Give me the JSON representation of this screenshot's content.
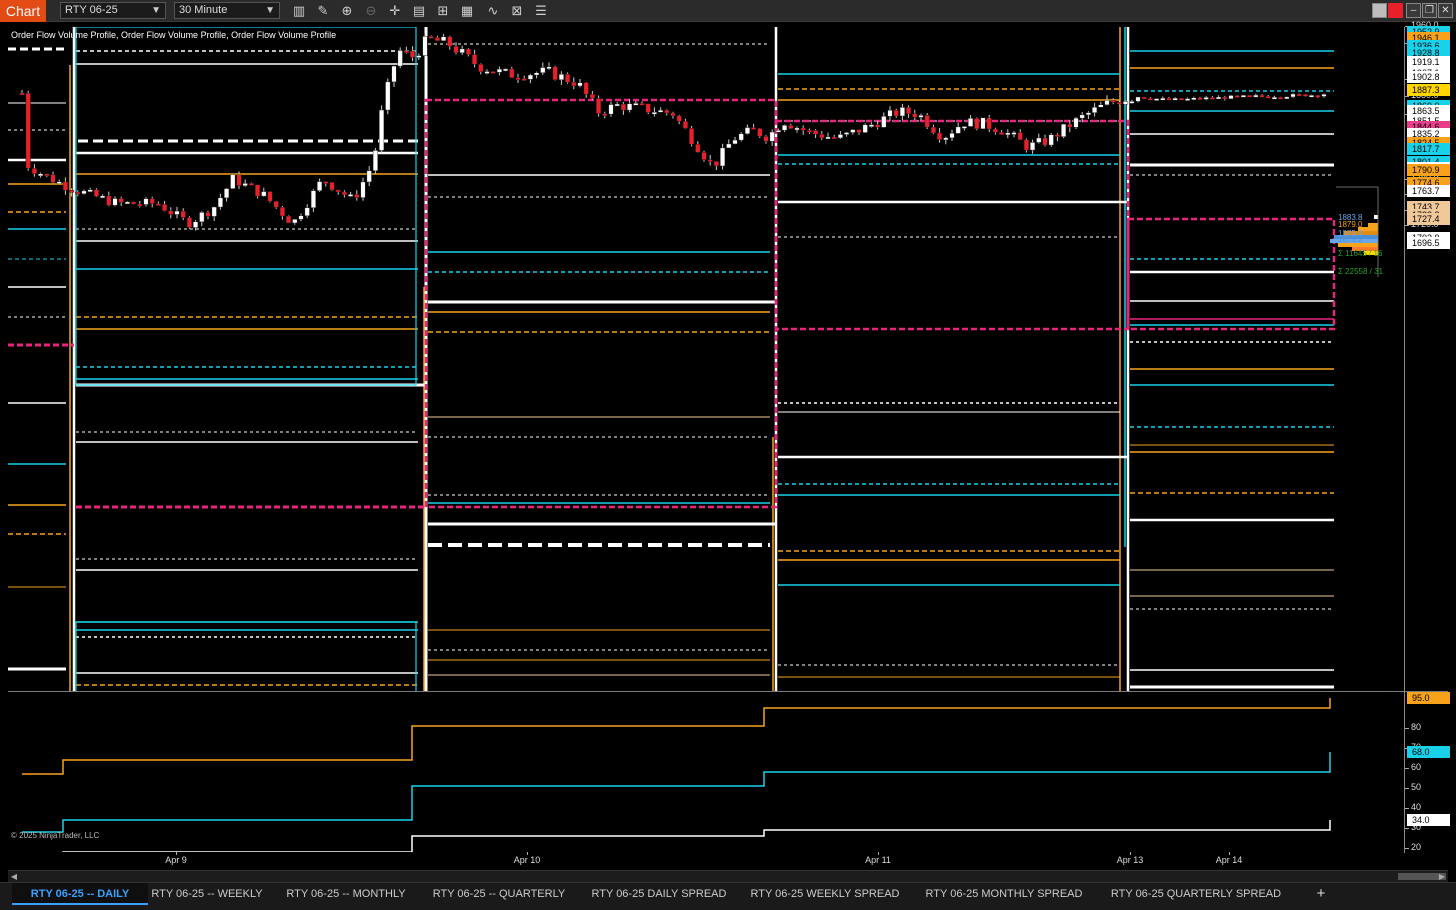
{
  "toolbar": {
    "chart_badge": "Chart",
    "instrument": "RTY 06-25",
    "timeframe": "30 Minute",
    "icons": [
      "bar-type-icon",
      "draw-pencil-icon",
      "zoom-in-icon",
      "zoom-out-icon",
      "crosshair-icon",
      "data-box-icon",
      "templates-icon",
      "strategies-icon",
      "indicators-icon",
      "properties-icon",
      "menu-icon"
    ],
    "window_buttons": [
      "color-swatch-icon",
      "close-red-icon",
      "minimize-icon",
      "maximize-icon",
      "close-icon"
    ]
  },
  "chart": {
    "indicator_label": "Order Flow Volume Profile, Order Flow Volume Profile, Order Flow Volume Profile",
    "copyright": "© 2025 NinjaTrader, LLC",
    "profile_values": {
      "p1": "1883.8",
      "p2": "1879.0",
      "p3": "1875.4",
      "p4": "1873.2",
      "vol1": "Σ 11645 / 16",
      "vol2": "Σ 22558 / 31"
    },
    "x_axis": [
      "Apr 9",
      "Apr 10",
      "Apr 11",
      "Apr 13",
      "Apr 14"
    ]
  },
  "chart_data": {
    "type": "candlestick",
    "instrument": "RTY 06-25",
    "timeframe": "30 Minute",
    "price_axis": {
      "range": [
        1690,
        1965
      ],
      "ticks": [
        "1960.0",
        "1940.0",
        "1900.0",
        "1880.0",
        "1860.0",
        "1780.0",
        "1760.0",
        "1740.0",
        "1720.0"
      ]
    },
    "price_labels": [
      {
        "text": "1952.9",
        "color": "#19d2ea"
      },
      {
        "text": "1946.1",
        "color": "#f7a21b"
      },
      {
        "text": "1936.6",
        "color": "#19d2ea"
      },
      {
        "text": "1928.8",
        "color": "#19d2ea"
      },
      {
        "text": "1919.1",
        "color": "#ffffff"
      },
      {
        "text": "1907.1",
        "color": "#ffffff"
      },
      {
        "text": "1902.8",
        "color": "#ffffff"
      },
      {
        "text": "1887.3",
        "color": "#ffd600"
      },
      {
        "text": "1869.0",
        "color": "#19d2ea"
      },
      {
        "text": "1863.5",
        "color": "#ffffff"
      },
      {
        "text": "1851.5",
        "color": "#ffffff"
      },
      {
        "text": "1844.6",
        "color": "#e83e8c"
      },
      {
        "text": "1835.2",
        "color": "#ffffff"
      },
      {
        "text": "1824.5",
        "color": "#f7a21b"
      },
      {
        "text": "1817.7",
        "color": "#19d2ea"
      },
      {
        "text": "1801.4",
        "color": "#19d2ea"
      },
      {
        "text": "1794.1",
        "color": "#ffffff"
      },
      {
        "text": "1790.9",
        "color": "#f7a21b"
      },
      {
        "text": "1774.6",
        "color": "#f7a21b"
      },
      {
        "text": "1763.7",
        "color": "#ffffff"
      },
      {
        "text": "1743.7",
        "color": "#f0c89a"
      },
      {
        "text": "1733.3",
        "color": "#f0c89a"
      },
      {
        "text": "1727.4",
        "color": "#f0c89a"
      },
      {
        "text": "1702.9",
        "color": "#ffffff"
      },
      {
        "text": "1696.5",
        "color": "#ffffff"
      }
    ],
    "indicator_axis": {
      "range": [
        18,
        98
      ],
      "ticks": [
        "80",
        "70",
        "60",
        "50",
        "40",
        "30",
        "20"
      ],
      "labels": [
        {
          "text": "95.0",
          "color": "#f7a21b"
        },
        {
          "text": "68.0",
          "color": "#19d2ea"
        },
        {
          "text": "34.0",
          "color": "#ffffff"
        }
      ]
    },
    "series": [
      {
        "name": "orange",
        "values": [
          57,
          64,
          64,
          81,
          81,
          90,
          90,
          95
        ]
      },
      {
        "name": "cyan",
        "values": [
          28,
          34,
          34,
          51,
          51,
          58,
          58,
          68
        ]
      },
      {
        "name": "white",
        "values": [
          14,
          18,
          18,
          26,
          26,
          29,
          29,
          34
        ]
      }
    ]
  },
  "tabs": [
    {
      "label": "RTY 06-25 -- DAILY",
      "active": true
    },
    {
      "label": "RTY 06-25 -- WEEKLY"
    },
    {
      "label": "RTY 06-25 -- MONTHLY"
    },
    {
      "label": "RTY 06-25 -- QUARTERLY"
    },
    {
      "label": "RTY 06-25 DAILY SPREAD"
    },
    {
      "label": "RTY 06-25 WEEKLY SPREAD"
    },
    {
      "label": "RTY 06-25 MONTHLY SPREAD"
    },
    {
      "label": "RTY 06-25 QUARTERLY SPREAD"
    }
  ],
  "tab_add": "+",
  "colors": {
    "orange": "#f7a21b",
    "cyan": "#19d2ea",
    "magenta": "#e8247f",
    "white": "#ffffff",
    "candle_up": "#ffffff",
    "candle_down": "#e8202a",
    "peach": "#f0c89a",
    "accent_tab": "#3aa0ff"
  }
}
